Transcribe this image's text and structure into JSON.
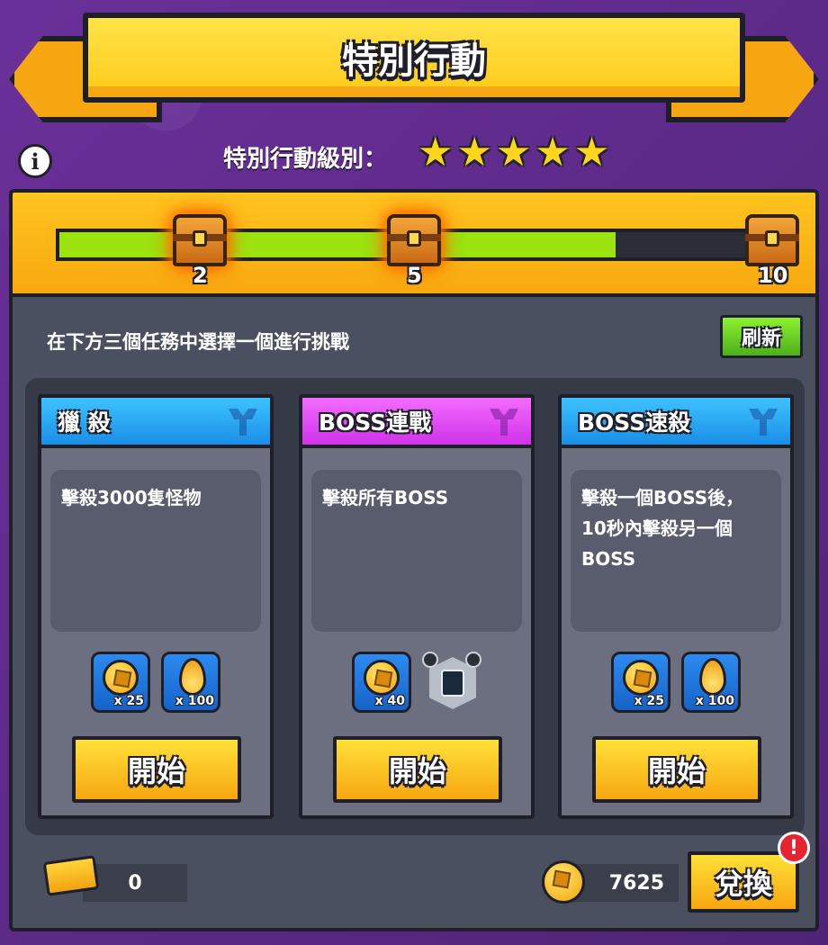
{
  "header": {
    "title": "特別行動"
  },
  "level": {
    "label": "特別行動級別：",
    "stars": 5
  },
  "progress": {
    "fraction": 0.8,
    "milestones": [
      {
        "label": "2",
        "position": 0.2
      },
      {
        "label": "5",
        "position": 0.5
      },
      {
        "label": "10",
        "position": 1.0
      }
    ]
  },
  "instruction": "在下方三個任務中選擇一個進行挑戰",
  "refresh_label": "刷新",
  "missions": [
    {
      "title": "獵 殺",
      "header_color": "#1e9bf0",
      "description": "擊殺3000隻怪物",
      "rewards": [
        {
          "icon": "gold-coin-icon",
          "qty": "x 25"
        },
        {
          "icon": "flame-icon",
          "qty": "x 100"
        }
      ],
      "start_label": "開始"
    },
    {
      "title": "BOSS連戰",
      "header_color": "#e14ef5",
      "description": "擊殺所有BOSS",
      "rewards": [
        {
          "icon": "gold-coin-icon",
          "qty": "x 40"
        },
        {
          "icon": "device-icon",
          "qty": ""
        }
      ],
      "start_label": "開始"
    },
    {
      "title": "BOSS速殺",
      "header_color": "#1e9bf0",
      "description": "擊殺一個BOSS後，\n10秒內擊殺另一個\nBOSS",
      "rewards": [
        {
          "icon": "gold-coin-icon",
          "qty": "x 25"
        },
        {
          "icon": "flame-icon",
          "qty": "x 100"
        }
      ],
      "start_label": "開始"
    }
  ],
  "footer": {
    "tickets": "0",
    "coins": "7625",
    "exchange_label": "兌換",
    "alert": "!"
  },
  "colors": {
    "background": "#5b2a86",
    "accent_yellow": "#ffc21f",
    "progress_green": "#9be20f"
  }
}
